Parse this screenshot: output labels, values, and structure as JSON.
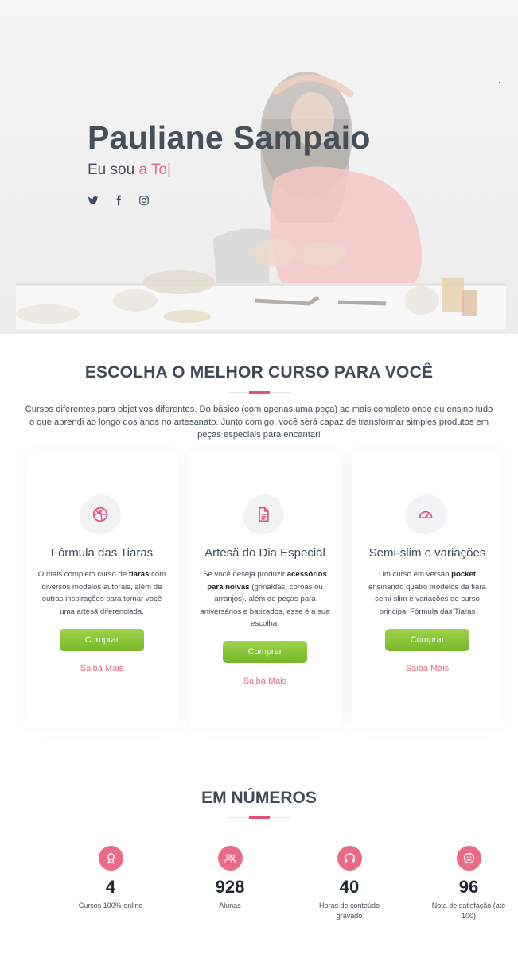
{
  "hero": {
    "name": "Pauliane Sampaio",
    "subtitle_prefix": "Eu sou ",
    "subtitle_typed": "a To",
    "subtitle_caret": "|",
    "social_icons": [
      "twitter-icon",
      "facebook-icon",
      "instagram-icon"
    ]
  },
  "courses": {
    "title": "ESCOLHA O MELHOR CURSO PARA VOCÊ",
    "intro": "Cursos diferentes para objetivos diferentes. Do básico (com apenas uma peça) ao mais completo onde eu ensino tudo o que aprendi ao longo dos anos no artesanato. Junto comigo, você será capaz de transformar simples produtos em peças especiais para encantar!",
    "cards": [
      {
        "icon": "dribbble-icon",
        "title": "Fórmula das Tiaras",
        "text_a": "O mais completo curso de ",
        "text_bold": "tiaras",
        "text_b": " com diversos modelos autorais, além de outras inspirações para tornar você uma artesã diferenciada.",
        "buy_label": "Comprar",
        "more_label": "Saiba Mais"
      },
      {
        "icon": "document-icon",
        "title": "Artesã do Dia Especial",
        "text_a": "Se você deseja produzir ",
        "text_bold": "acessórios para noivas",
        "text_b": " (grinaldas, coroas ou arranjos), além de peças para aniversários e batizados, esse é a sua escolha!",
        "buy_label": "Comprar",
        "more_label": "Saiba Mais"
      },
      {
        "icon": "speedometer-icon",
        "title": "Semi-slim e variações",
        "text_a": "Um curso em versão ",
        "text_bold": "pocket",
        "text_b": " ensinando quatro modelos da tiara semi-slim e variações do curso principal Fórmula das Tiaras",
        "buy_label": "Comprar",
        "more_label": "Saiba Mais"
      }
    ]
  },
  "numbers": {
    "title": "EM NÚMEROS",
    "stats": [
      {
        "icon": "award-icon",
        "value": "4",
        "label": "Cursos 100% online"
      },
      {
        "icon": "users-icon",
        "value": "928",
        "label": "Alunas"
      },
      {
        "icon": "headset-icon",
        "value": "40",
        "label": "Horas de conteúdo gravado"
      },
      {
        "icon": "smile-icon",
        "value": "96",
        "label": "Nota de satisfação (até 100)"
      }
    ]
  },
  "colors": {
    "accent": "#e96b86",
    "heading": "#45505b",
    "button_green": "#8cc63f"
  }
}
